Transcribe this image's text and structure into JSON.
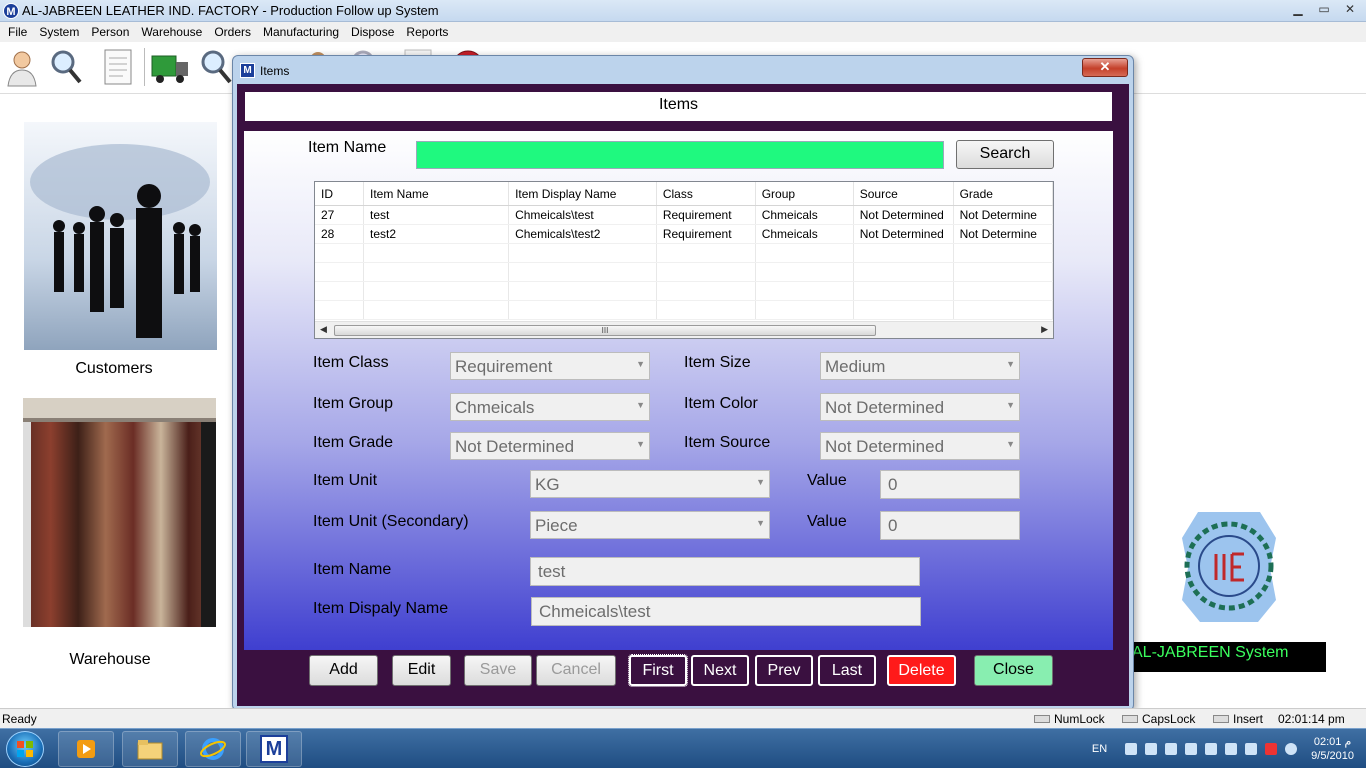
{
  "app": {
    "title": "AL-JABREEN LEATHER IND. FACTORY - Production Follow up System",
    "icon_letter": "M",
    "window_controls": [
      "▁",
      "▭",
      "✕"
    ]
  },
  "menu": [
    "File",
    "System",
    "Person",
    "Warehouse",
    "Orders",
    "Manufacturing",
    "Dispose",
    "Reports"
  ],
  "toolbar_icons": [
    "person-icon",
    "search-icon",
    "document-icon",
    "truck-icon",
    "search-icon",
    "document-icon",
    "person-icon",
    "search-icon",
    "document-icon",
    "stop-icon"
  ],
  "background": {
    "customers_label": "Customers",
    "warehouse_label": "Warehouse",
    "system_label": "AL-JABREEN System"
  },
  "dialog": {
    "icon_letter": "M",
    "window_title": "Items",
    "close_glyph": "✕",
    "header_title": "Items",
    "search": {
      "label": "Item Name",
      "value": "",
      "button": "Search"
    },
    "grid": {
      "columns": [
        "ID",
        "Item Name",
        "Item Display Name",
        "Class",
        "Group",
        "Source",
        "Grade"
      ],
      "rows": [
        [
          "27",
          "test",
          "Chmeicals\\test",
          "Requirement",
          "Chmeicals",
          "Not Determined",
          "Not Determine"
        ],
        [
          "28",
          "test2",
          "Chemicals\\test2",
          "Requirement",
          "Chmeicals",
          "Not Determined",
          "Not Determine"
        ]
      ],
      "empty_rows": 4,
      "scroll_left": "◀",
      "scroll_right": "▶",
      "scroll_grip": "III"
    },
    "fields": {
      "item_class_label": "Item Class",
      "item_class_value": "Requirement",
      "item_size_label": "Item Size",
      "item_size_value": "Medium",
      "item_group_label": "Item Group",
      "item_group_value": "Chmeicals",
      "item_color_label": "Item Color",
      "item_color_value": "Not Determined",
      "item_grade_label": "Item Grade",
      "item_grade_value": "Not Determined",
      "item_source_label": "Item Source",
      "item_source_value": "Not Determined",
      "item_unit_label": "Item Unit",
      "item_unit_value": "KG",
      "value_label": "Value",
      "value_1": "0",
      "item_unit2_label": "Item Unit (Secondary)",
      "item_unit2_value": "Piece",
      "value_2": "0",
      "item_name_label": "Item Name",
      "item_name_value": "test",
      "item_display_label": "Item Dispaly Name",
      "item_display_value": "Chmeicals\\test"
    },
    "caret": "▼",
    "buttons": {
      "add": "Add",
      "edit": "Edit",
      "save": "Save",
      "cancel": "Cancel",
      "first": "First",
      "next": "Next",
      "prev": "Prev",
      "last": "Last",
      "delete": "Delete",
      "close": "Close"
    },
    "colors": {
      "dialog_frame": "#3a1040",
      "search_field": "#1ff97f",
      "delete_button": "#ff1a1a",
      "close_button": "#88eeb0"
    }
  },
  "statusbar": {
    "ready": "Ready",
    "numlock": "NumLock",
    "capslock": "CapsLock",
    "insert": "Insert",
    "time": "02:01:14 pm"
  },
  "taskbar": {
    "lang": "EN",
    "clock_time": "02:01 م",
    "clock_date": "9/5/2010",
    "pinned": [
      "media-player-icon",
      "explorer-icon",
      "internet-explorer-icon",
      "app-m-icon"
    ],
    "app_letter": "M"
  }
}
